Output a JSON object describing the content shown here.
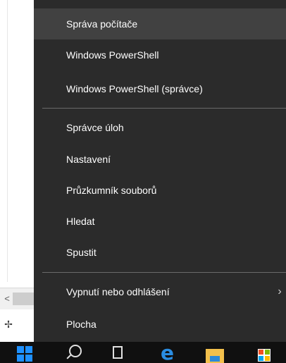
{
  "context_menu": {
    "items": [
      {
        "label": "Správa počítače"
      },
      {
        "label": "Windows PowerShell"
      },
      {
        "label": "Windows PowerShell (správce)"
      },
      {
        "label": "Správce úloh"
      },
      {
        "label": "Nastavení"
      },
      {
        "label": "Průzkumník souborů"
      },
      {
        "label": "Hledat"
      },
      {
        "label": "Spustit"
      },
      {
        "label": "Vypnutí nebo odhlášení",
        "submenu_icon": "chevron-right-icon"
      },
      {
        "label": "Plocha"
      }
    ]
  },
  "left_window": {
    "scroll_arrow": "<",
    "move_icon": "move-icon"
  },
  "taskbar": {
    "icons": [
      "start-icon",
      "search-icon",
      "task-view-icon",
      "edge-icon",
      "file-explorer-icon",
      "store-icon"
    ]
  },
  "colors": {
    "menu_bg": "#2b2b2b",
    "menu_hover": "#414141",
    "taskbar_bg": "#101010",
    "accent": "#1e90ff"
  }
}
